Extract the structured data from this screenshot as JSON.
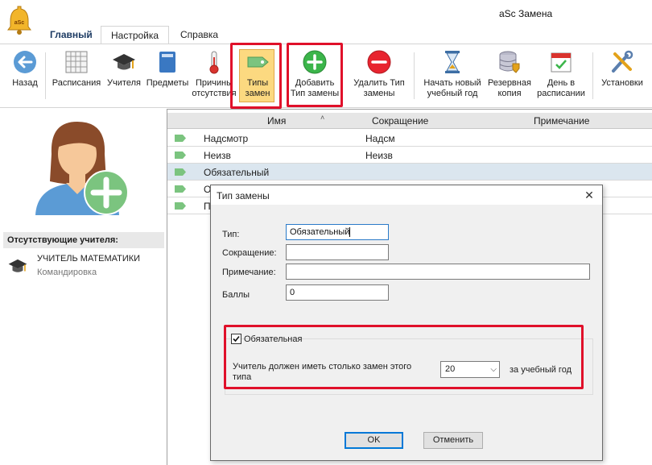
{
  "app": {
    "title": "aSc Замена",
    "logo_text": "aSc"
  },
  "menu": {
    "tabs": [
      "Главный",
      "Настройка",
      "Справка"
    ]
  },
  "ribbon": {
    "back": "Назад",
    "schedules": "Расписания",
    "teachers": "Учителя",
    "subjects": "Предметы",
    "reasons": [
      "Причины",
      "отсутствия"
    ],
    "sub_types": [
      "Типы",
      "замен"
    ],
    "add_type": [
      "Добавить",
      "Тип замены"
    ],
    "delete_type": [
      "Удалить Тип",
      "замены"
    ],
    "new_year": [
      "Начать новый",
      "учебный год"
    ],
    "backup": [
      "Резервная",
      "копия"
    ],
    "day_schedule": [
      "День в",
      "расписании"
    ],
    "settings": "Установки"
  },
  "left_panel": {
    "absent_header": "Отсутствующие учителя:",
    "absent_teacher": "УЧИТЕЛЬ МАТЕМАТИКИ",
    "absent_reason": "Командировка"
  },
  "table": {
    "headers": {
      "name": "Имя",
      "short": "Сокращение",
      "note": "Примечание"
    },
    "rows": [
      {
        "name": "Надсмотр",
        "short": "Надсм"
      },
      {
        "name": "Неизв",
        "short": "Неизв"
      },
      {
        "name": "Обязательный",
        "short": ""
      },
      {
        "name": "О",
        "short": ""
      },
      {
        "name": "П",
        "short": ""
      }
    ]
  },
  "dialog": {
    "title": "Тип замены",
    "type_label": "Тип:",
    "type_value": "Обязательный",
    "short_label": "Сокращение:",
    "short_value": "",
    "note_label": "Примечание:",
    "note_value": "",
    "points_label": "Баллы",
    "points_value": "0",
    "mandatory_label": "Обязательная",
    "mandatory_checked": true,
    "count_label": [
      "Учитель должен иметь столько замен этого",
      "типа"
    ],
    "count_value": "20",
    "per_year": "за учебный год",
    "ok": "OK",
    "cancel": "Отменить"
  },
  "colors": {
    "accent": "#0078d7",
    "highlight": "#e0102a",
    "tag": "#7bc47f",
    "selected_row": "#dbe6ef"
  }
}
